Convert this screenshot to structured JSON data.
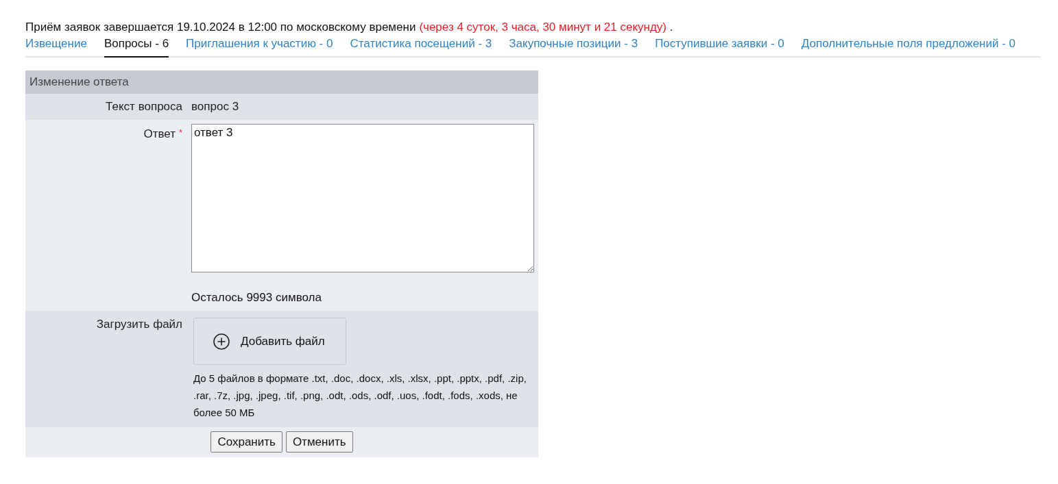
{
  "deadline": {
    "text": "Приём заявок завершается 19.10.2024 в 12:00 по московскому времени",
    "countdown": "(через 4 суток, 3 часа, 30 минут и 21 секунду)",
    "end": "."
  },
  "tabs": [
    {
      "label": "Извещение",
      "selected": false
    },
    {
      "label": "Вопросы - 6",
      "selected": true
    },
    {
      "label": "Приглашения к участию - 0",
      "selected": false
    },
    {
      "label": "Статистика посещений - 3",
      "selected": false
    },
    {
      "label": "Закупочные позиции - 3",
      "selected": false
    },
    {
      "label": "Поступившие заявки - 0",
      "selected": false
    },
    {
      "label": "Дополнительные поля предложений - 0",
      "selected": false
    }
  ],
  "form": {
    "title": "Изменение ответа",
    "question": {
      "label": "Текст вопроса",
      "value": "вопрос 3"
    },
    "answer": {
      "label": "Ответ",
      "required_mark": "*",
      "value": "ответ 3",
      "counter": "Осталось 9993 символа"
    },
    "upload": {
      "label": "Загрузить файл",
      "button": "Добавить файл",
      "hint": "До 5 файлов в формате .txt, .doc, .docx, .xls, .xlsx, .ppt, .pptx, .pdf, .zip, .rar, .7z, .jpg, .jpeg, .tif, .png, .odt, .ods, .odf, .uos, .fodt, .fods, .xods, не более 50 МБ"
    },
    "buttons": [
      "Сохранить",
      "Отменить"
    ]
  }
}
